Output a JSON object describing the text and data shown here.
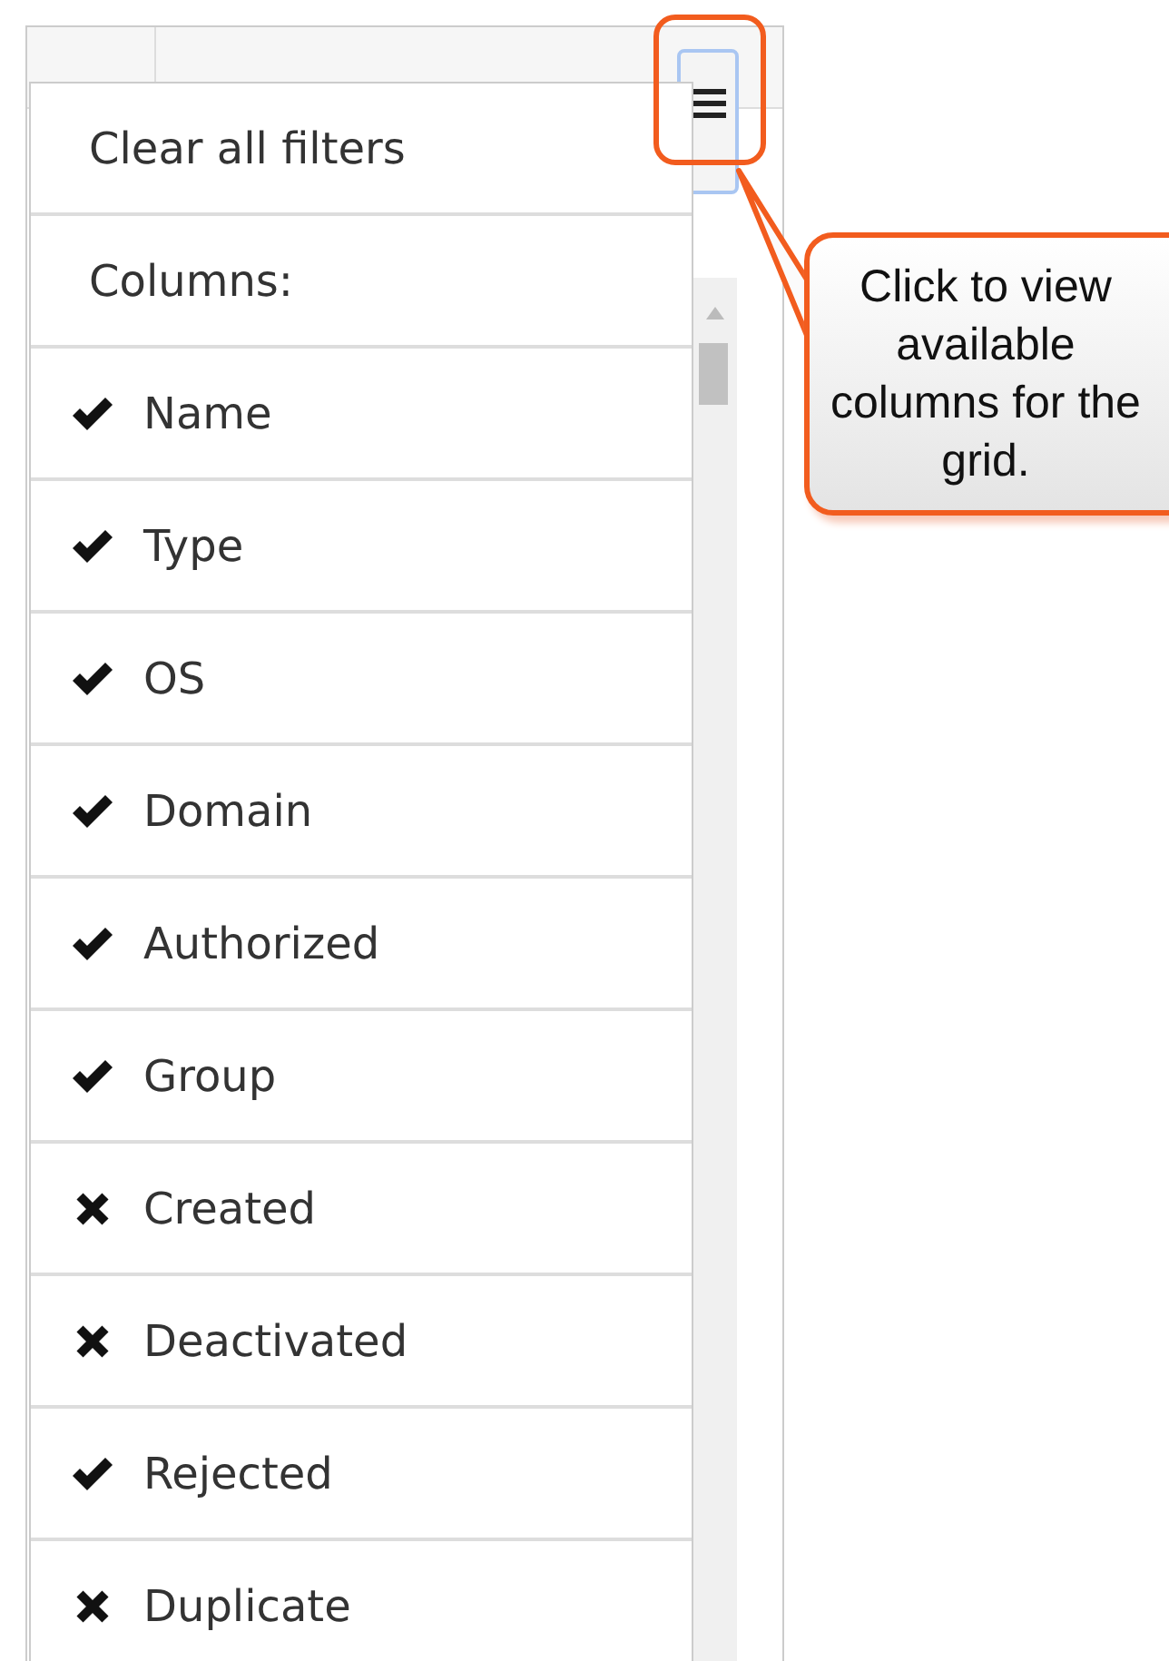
{
  "menu": {
    "clear_filters": "Clear all filters",
    "section_label": "Columns:",
    "columns": [
      {
        "label": "Name",
        "checked": true
      },
      {
        "label": "Type",
        "checked": true
      },
      {
        "label": "OS",
        "checked": true
      },
      {
        "label": "Domain",
        "checked": true
      },
      {
        "label": "Authorized",
        "checked": true
      },
      {
        "label": "Group",
        "checked": true
      },
      {
        "label": "Created",
        "checked": false
      },
      {
        "label": "Deactivated",
        "checked": false
      },
      {
        "label": "Rejected",
        "checked": true
      },
      {
        "label": "Duplicate",
        "checked": false
      }
    ]
  },
  "callout": {
    "text": "Click to view available columns for the grid."
  }
}
